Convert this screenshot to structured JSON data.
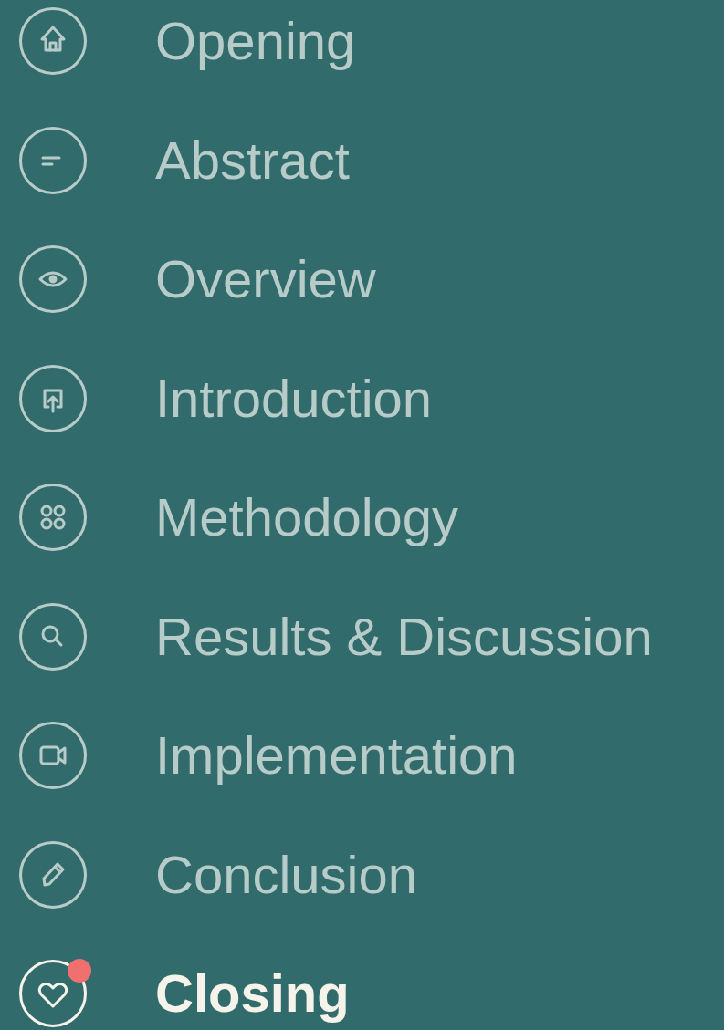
{
  "menu": {
    "items": [
      {
        "label": "Opening",
        "selected": false,
        "badge": false
      },
      {
        "label": "Abstract",
        "selected": false,
        "badge": false
      },
      {
        "label": "Overview",
        "selected": false,
        "badge": false
      },
      {
        "label": "Introduction",
        "selected": false,
        "badge": false
      },
      {
        "label": "Methodology",
        "selected": false,
        "badge": false
      },
      {
        "label": "Results & Discussion",
        "selected": false,
        "badge": false
      },
      {
        "label": "Implementation",
        "selected": false,
        "badge": false
      },
      {
        "label": "Conclusion",
        "selected": false,
        "badge": false
      },
      {
        "label": "Closing",
        "selected": true,
        "badge": true
      }
    ]
  }
}
